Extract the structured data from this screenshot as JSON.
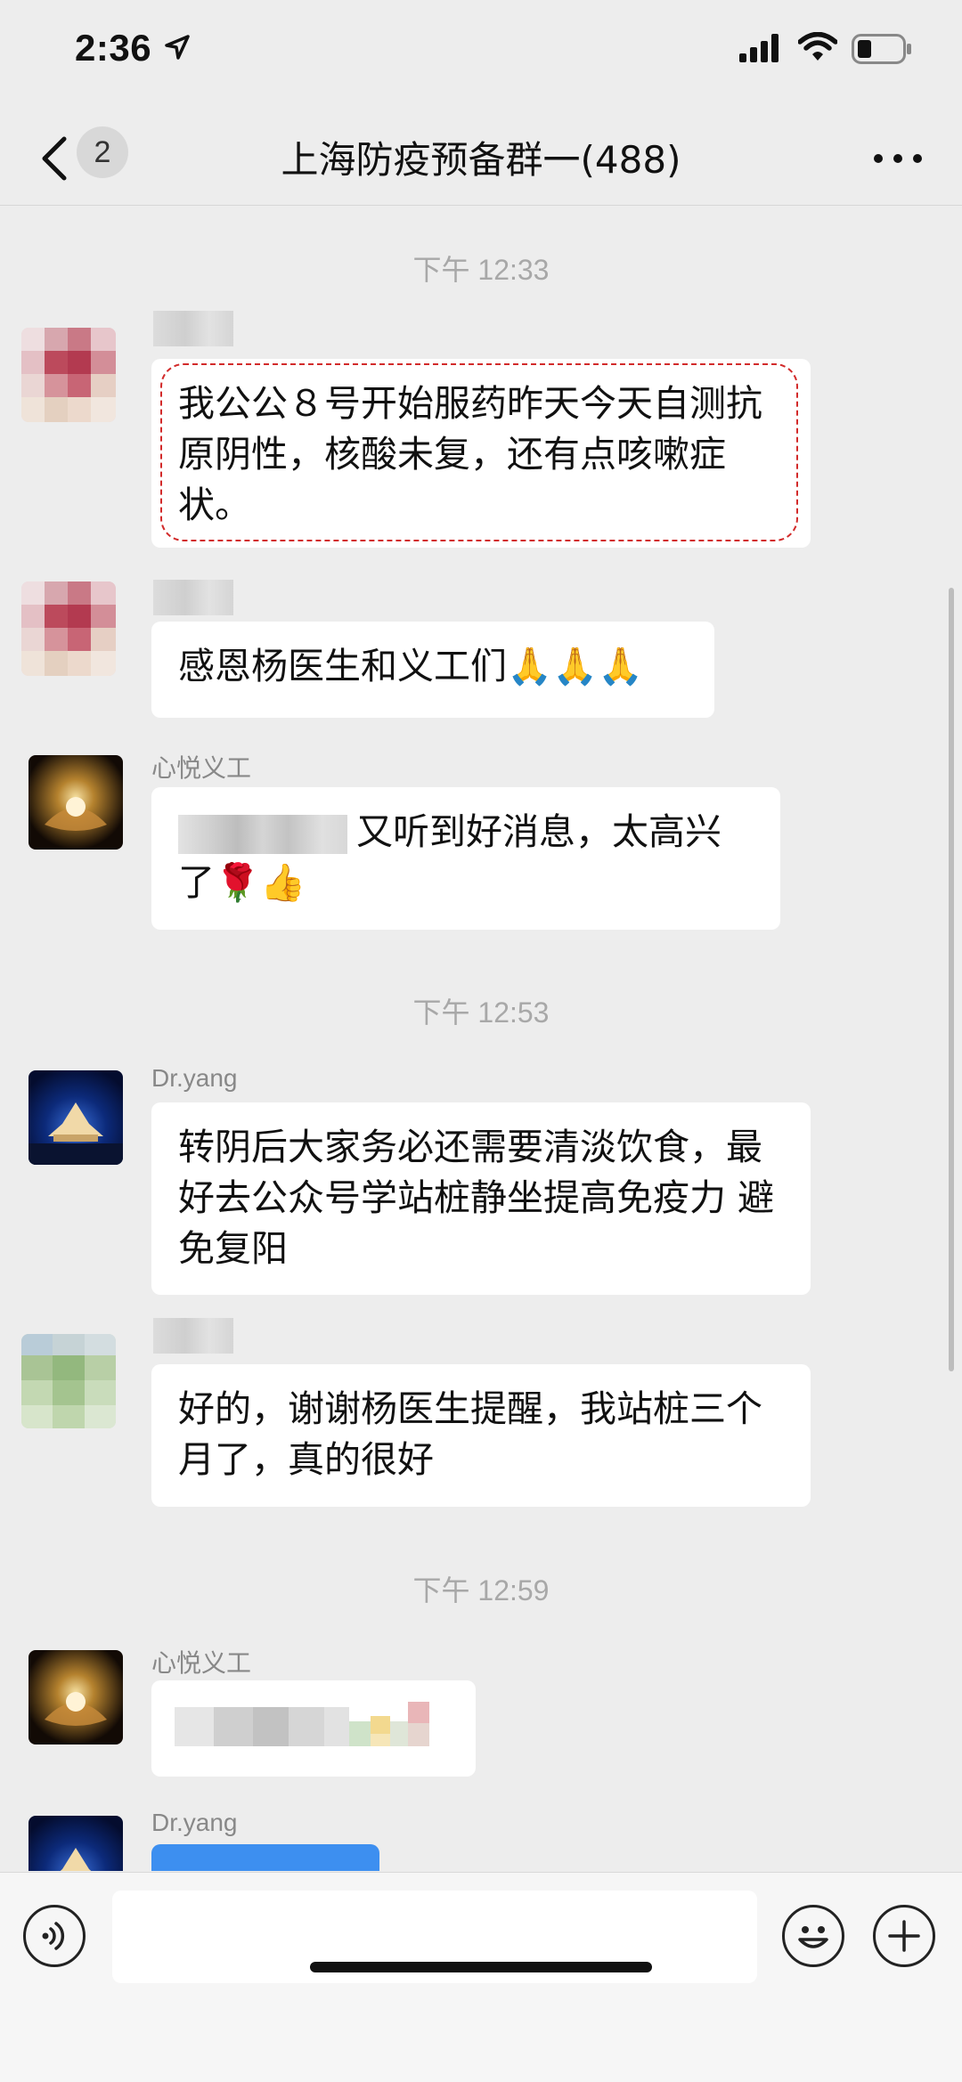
{
  "status": {
    "time": "2:36"
  },
  "nav": {
    "badge": "2",
    "title": "上海防疫预备群一(488)"
  },
  "messages": {
    "ts1": "下午 12:33",
    "m1": {
      "text": "我公公８号开始服药昨天今天自测抗原阴性，核酸未复，还有点咳嗽症状。"
    },
    "m2": {
      "text": "感恩杨医生和义工们🙏🙏🙏"
    },
    "m3": {
      "name": "心悦义工",
      "text": "又听到好消息，太高兴了🌹👍"
    },
    "ts2": "下午 12:53",
    "m4": {
      "name": "Dr.yang",
      "text": "转阴后大家务必还需要清淡饮食，最好去公众号学站桩静坐提高免疫力 避免复阳"
    },
    "m5": {
      "text": "好的，谢谢杨医生提醒，我站桩三个月了，真的很好"
    },
    "ts3": "下午 12:59",
    "m6": {
      "name": "心悦义工"
    },
    "m7": {
      "name": "Dr.yang"
    }
  },
  "icons": [
    "back-chevron-icon",
    "more-icon",
    "voice-icon",
    "emoji-icon",
    "plus-icon",
    "location-arrow-icon",
    "signal-icon",
    "wifi-icon",
    "battery-icon"
  ]
}
